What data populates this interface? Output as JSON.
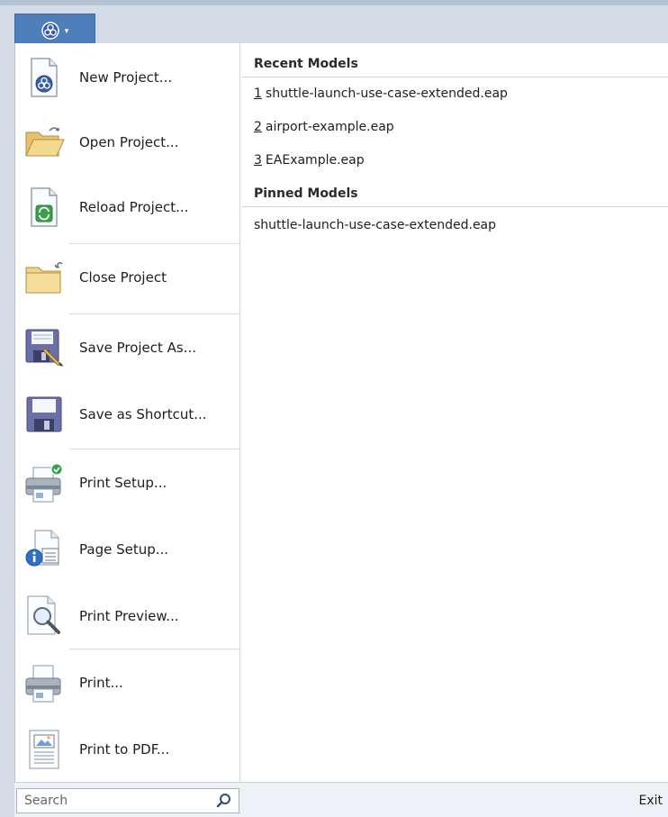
{
  "colors": {
    "accent": "#4f7fba",
    "panel_bg": "#ffffff",
    "chrome_bg": "#d4dce7"
  },
  "app_button": {
    "icon": "ea-logo-icon",
    "caret": "▾"
  },
  "menu": {
    "items": [
      {
        "label": "New Project...",
        "icon": "new-project-icon"
      },
      {
        "label": "Open Project...",
        "icon": "open-folder-icon"
      },
      {
        "label": "Reload Project...",
        "icon": "reload-icon"
      },
      {
        "label": "Close Project",
        "icon": "close-folder-icon"
      },
      {
        "label": "Save Project As...",
        "icon": "save-as-icon"
      },
      {
        "label": "Save as Shortcut...",
        "icon": "save-shortcut-icon"
      },
      {
        "label": "Print Setup...",
        "icon": "print-setup-icon"
      },
      {
        "label": "Page Setup...",
        "icon": "page-setup-icon"
      },
      {
        "label": "Print Preview...",
        "icon": "print-preview-icon"
      },
      {
        "label": "Print...",
        "icon": "printer-icon"
      },
      {
        "label": "Print to PDF...",
        "icon": "pdf-icon"
      }
    ]
  },
  "recent": {
    "title": "Recent Models",
    "items": [
      {
        "num": "1",
        "name": "shuttle-launch-use-case-extended.eap"
      },
      {
        "num": "2",
        "name": "airport-example.eap"
      },
      {
        "num": "3",
        "name": "EAExample.eap"
      }
    ]
  },
  "pinned": {
    "title": "Pinned Models",
    "items": [
      {
        "name": "shuttle-launch-use-case-extended.eap"
      }
    ]
  },
  "bottom": {
    "search_placeholder": "Search",
    "exit_label": "Exit"
  }
}
